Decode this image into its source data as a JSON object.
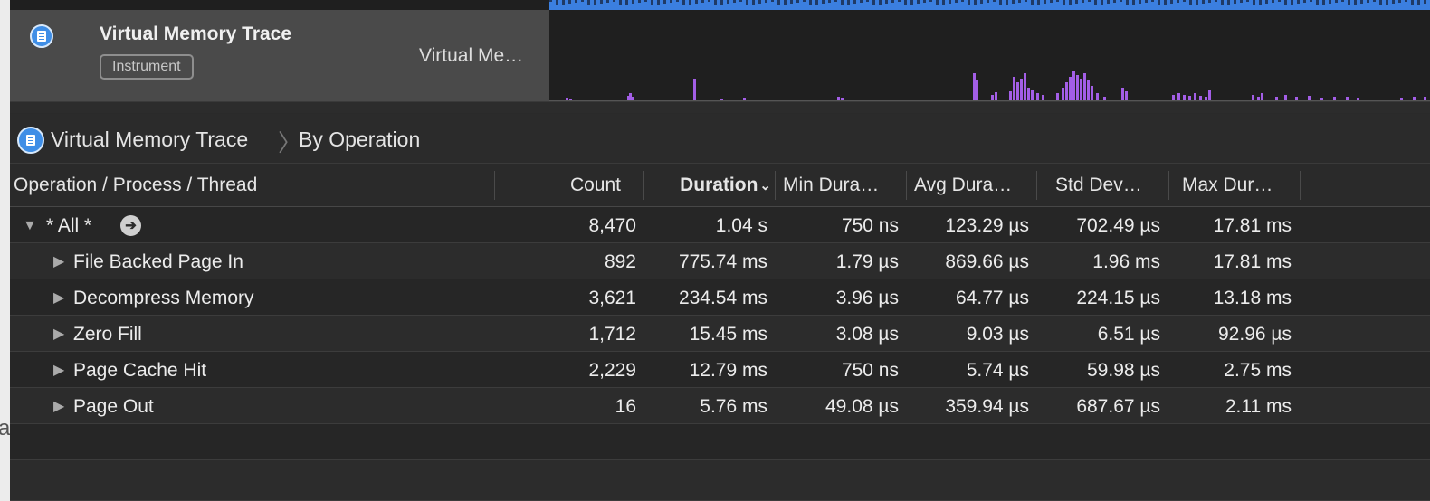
{
  "track": {
    "title": "Virtual Memory Trace",
    "badge": "Instrument",
    "right_label": "Virtual Me…",
    "icon": "instrument-doc-icon",
    "graph_color": "#a35ee6",
    "top_strip_color": "#3b7fe0"
  },
  "breadcrumb": {
    "items": [
      "Virtual Memory Trace",
      "By Operation"
    ],
    "separator": "〉"
  },
  "table": {
    "columns": {
      "name": "Operation / Process / Thread",
      "count": "Count",
      "duration": "Duration",
      "min": "Min Dura…",
      "avg": "Avg Dura…",
      "std": "Std Dev…",
      "max": "Max Dur…"
    },
    "sorted_by": "Duration",
    "rows": [
      {
        "name": "* All *",
        "count": "8,470",
        "duration": "1.04 s",
        "min": "750 ns",
        "avg": "123.29 µs",
        "std": "702.49 µs",
        "max": "17.81 ms",
        "expanded": true
      },
      {
        "name": "File Backed Page In",
        "count": "892",
        "duration": "775.74 ms",
        "min": "1.79 µs",
        "avg": "869.66 µs",
        "std": "1.96 ms",
        "max": "17.81 ms"
      },
      {
        "name": "Decompress Memory",
        "count": "3,621",
        "duration": "234.54 ms",
        "min": "3.96 µs",
        "avg": "64.77 µs",
        "std": "224.15 µs",
        "max": "13.18 ms"
      },
      {
        "name": "Zero Fill",
        "count": "1,712",
        "duration": "15.45 ms",
        "min": "3.08 µs",
        "avg": "9.03 µs",
        "std": "6.51 µs",
        "max": "92.96 µs"
      },
      {
        "name": "Page Cache Hit",
        "count": "2,229",
        "duration": "12.79 ms",
        "min": "750 ns",
        "avg": "5.74 µs",
        "std": "59.98 µs",
        "max": "2.75 ms"
      },
      {
        "name": "Page Out",
        "count": "16",
        "duration": "5.76 ms",
        "min": "49.08 µs",
        "avg": "359.94 µs",
        "std": "687.67 µs",
        "max": "2.11 ms"
      }
    ]
  },
  "left_edge_glyph": "a"
}
